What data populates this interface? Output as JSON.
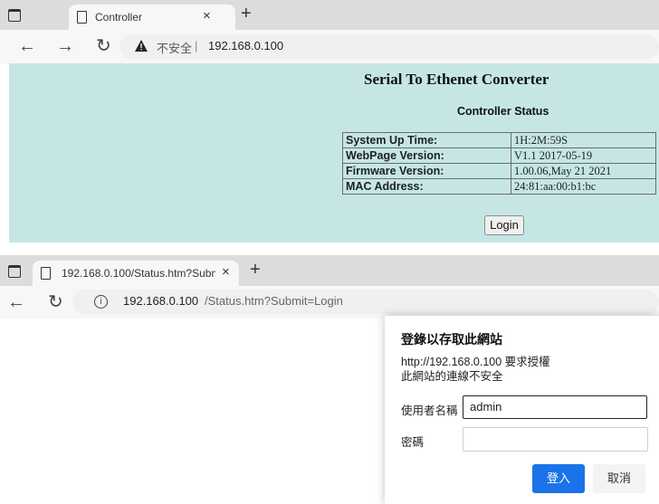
{
  "top": {
    "tab_title": "Controller",
    "address_warning": "不安全",
    "address_separator": "|",
    "address_url": "192.168.0.100",
    "page_title": "Serial To Ethenet Converter",
    "subtitle": "Controller Status",
    "status_rows": [
      {
        "key": "System Up Time:",
        "value": "1H:2M:59S"
      },
      {
        "key": "WebPage Version:",
        "value": "V1.1 2017-05-19"
      },
      {
        "key": "Firmware Version:",
        "value": "1.00.06,May 21 2021"
      },
      {
        "key": "MAC Address:",
        "value": "24:81:aa:00:b1:bc"
      }
    ],
    "login_label": "Login"
  },
  "bottom": {
    "tab_title": "192.168.0.100/Status.htm?Submi",
    "address_host": "192.168.0.100",
    "address_path": "/Status.htm?Submit=Login",
    "dialog": {
      "title": "登錄以存取此網站",
      "line1": "http://192.168.0.100 要求授權",
      "line2": "此網站的連線不安全",
      "username_label": "使用者名稱",
      "username_value": "admin",
      "password_label": "密碼",
      "password_value": "",
      "login_button": "登入",
      "cancel_button": "取消"
    }
  },
  "colors": {
    "page_bg": "#c6e6e6",
    "primary_button": "#1a73e8"
  },
  "icons": [
    "window-icon",
    "page-icon",
    "close-icon",
    "new-tab-icon",
    "back-icon",
    "forward-icon",
    "reload-icon",
    "warning-icon",
    "info-icon"
  ]
}
